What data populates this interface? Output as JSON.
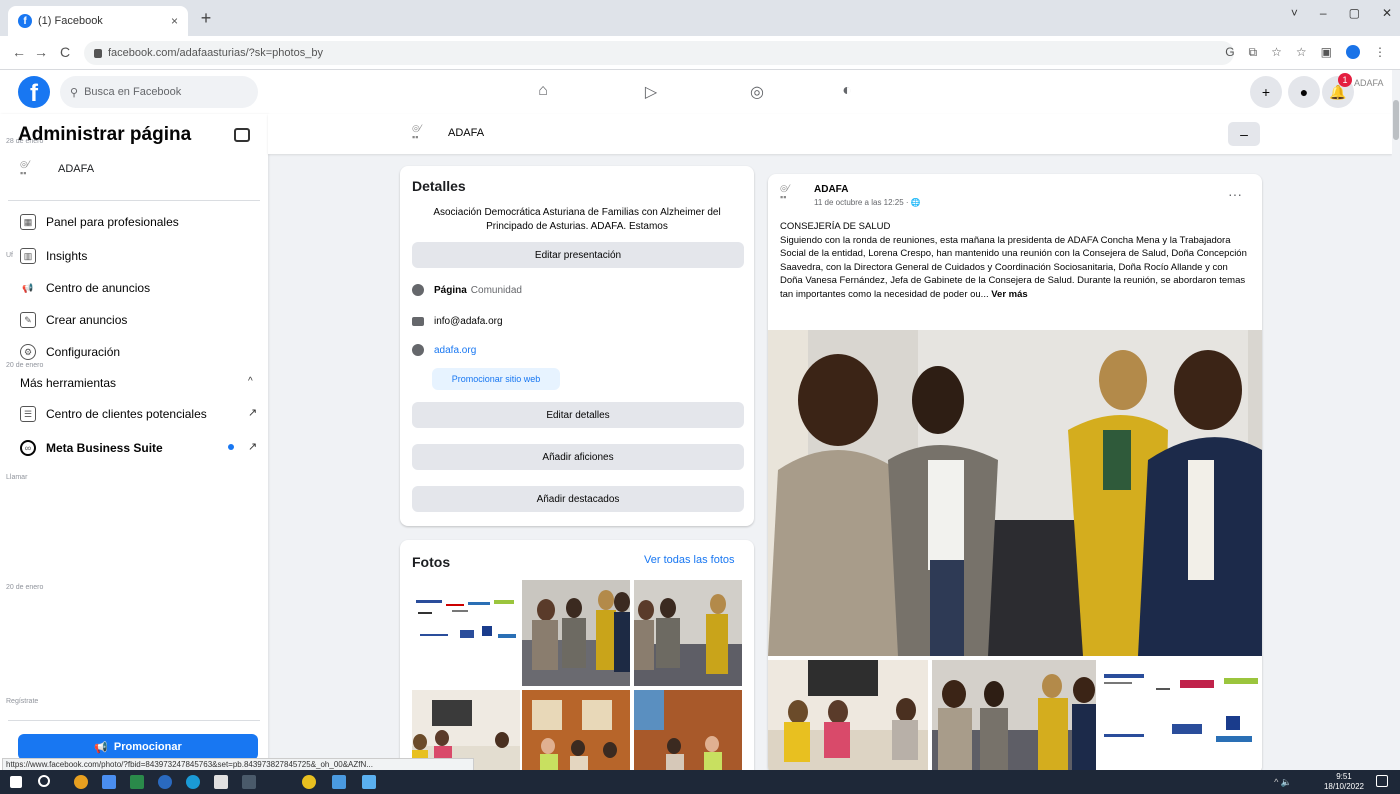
{
  "browser": {
    "tab_title": "(1) Facebook",
    "tab_close": "×",
    "new_tab": "+",
    "url": "facebook.com/adafaasturias/?sk=photos_by",
    "window_controls": [
      "˅",
      "–",
      "▢",
      "✕"
    ]
  },
  "fb_header": {
    "search_placeholder": "Busca en Facebook",
    "nav_icons": [
      "home-icon",
      "watch-icon",
      "groups-icon",
      "gaming-icon"
    ],
    "create": "+",
    "notifications_count": "1",
    "avatar_text": "ADAFA"
  },
  "sidebar": {
    "title": "Administrar página",
    "ghost_date_1": "28 de enero",
    "page_name": "ADAFA",
    "ghost_ui": "Uf",
    "items": [
      {
        "label": "Panel para profesionales",
        "icon": "dashboard-icon"
      },
      {
        "label": "Insights",
        "icon": "insights-icon"
      },
      {
        "label": "Centro de anuncios",
        "icon": "megaphone-icon"
      },
      {
        "label": "Crear anuncios",
        "icon": "pencil-icon"
      },
      {
        "label": "Configuración",
        "icon": "gear-icon"
      }
    ],
    "ghost_date_2": "20 de enero",
    "more_tools": "Más herramientas",
    "tools": [
      {
        "label": "Centro de clientes potenciales",
        "icon": "leads-icon"
      },
      {
        "label": "Meta Business Suite",
        "icon": "meta-icon"
      }
    ],
    "ghost_label": "Llamar",
    "ghost_date_3": "20 de enero",
    "ghost_label_2": "Regístrate",
    "promote_label": "Promocionar"
  },
  "page_strip": {
    "name": "ADAFA",
    "more": "–"
  },
  "details": {
    "title": "Detalles",
    "description": "Asociación Democrática Asturiana de Familias con Alzheimer del Principado de Asturias. ADAFA. Estamos",
    "edit_intro": "Editar presentación",
    "category_label": "Página",
    "category_value": "Comunidad",
    "email": "info@adafa.org",
    "website": "adafa.org",
    "promote_site": "Promocionar sitio web",
    "edit_details": "Editar detalles",
    "add_hobbies": "Añadir aficiones",
    "add_featured": "Añadir destacados"
  },
  "photos": {
    "title": "Fotos",
    "see_all": "Ver todas las fotos"
  },
  "post": {
    "author": "ADAFA",
    "date": "11 de octubre a las 12:25 · 🌐",
    "menu": "···",
    "text": "CONSEJERÍA DE SALUD\nSiguiendo con la ronda de reuniones, esta mañana la presidenta de ADAFA Concha Mena y la Trabajadora Social de la entidad, Lorena Crespo, han mantenido una reunión con la Consejera de Salud, Doña Concepción Saavedra, con la Directora General de Cuidados y Coordinación Sociosanitaria, Doña Rocío Allande y con Doña Vanesa Fernández, Jefa de Gabinete de la Consejera de Salud. Durante la reunión, se abordaron temas tan importantes como la necesidad de poder ou...",
    "see_more": "Ver más"
  },
  "status_url": "https://www.facebook.com/photo/?fbid=843973247845763&set=pb.843973827845725&_oh_00&AZfN...",
  "taskbar": {
    "tray": "^ 🔈",
    "time": "9:51",
    "date": "18/10/2022"
  }
}
